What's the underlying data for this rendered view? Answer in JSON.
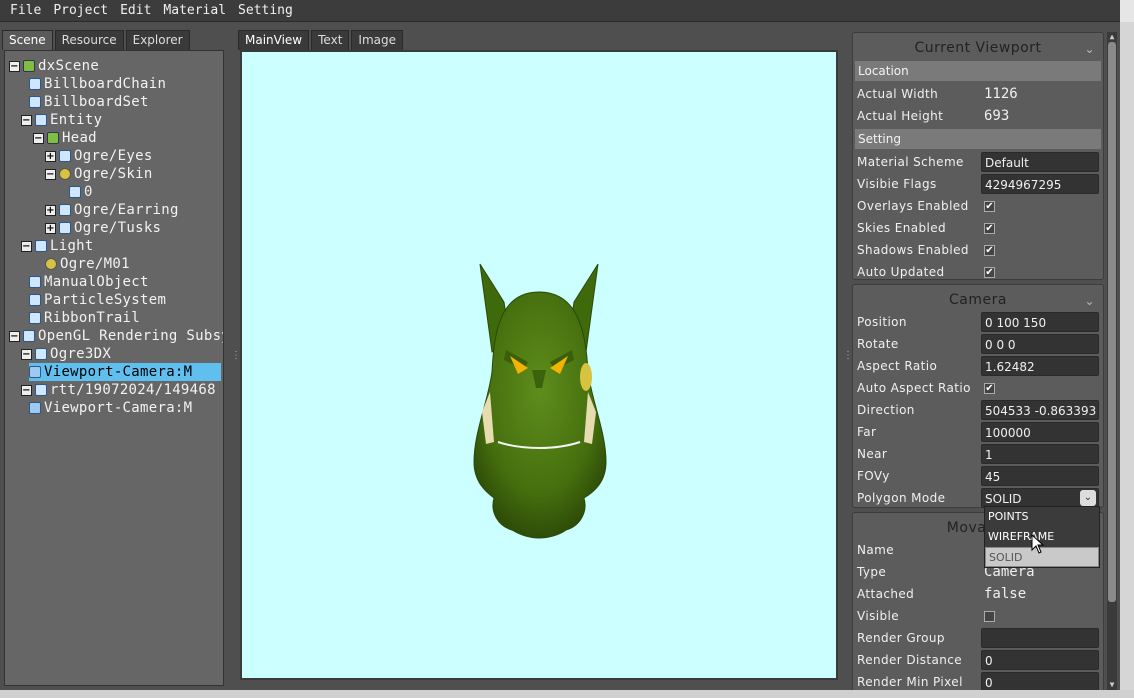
{
  "menu": [
    "File",
    "Project",
    "Edit",
    "Material",
    "Setting"
  ],
  "left_tabs": [
    "Scene",
    "Resource",
    "Explorer"
  ],
  "tree": [
    {
      "label": "dxScene",
      "exp": "−",
      "icon": "scene"
    },
    {
      "label": "BillboardChain",
      "exp": "",
      "icon": "node"
    },
    {
      "label": "BillboardSet",
      "exp": "",
      "icon": "node"
    },
    {
      "label": "Entity",
      "exp": "−",
      "icon": "node"
    },
    {
      "label": "Head",
      "exp": "−",
      "icon": "scene"
    },
    {
      "label": "Ogre/Eyes",
      "exp": "+",
      "icon": "node"
    },
    {
      "label": "Ogre/Skin",
      "exp": "−",
      "icon": "mat"
    },
    {
      "label": "0",
      "exp": "",
      "icon": "node"
    },
    {
      "label": "Ogre/Earring",
      "exp": "+",
      "icon": "node"
    },
    {
      "label": "Ogre/Tusks",
      "exp": "+",
      "icon": "node"
    },
    {
      "label": "Light",
      "exp": "−",
      "icon": "node"
    },
    {
      "label": "Ogre/M01",
      "exp": "",
      "icon": "mat"
    },
    {
      "label": "ManualObject",
      "exp": "",
      "icon": "node"
    },
    {
      "label": "ParticleSystem",
      "exp": "",
      "icon": "node"
    },
    {
      "label": "RibbonTrail",
      "exp": "",
      "icon": "node"
    },
    {
      "label": "OpenGL Rendering Subsy",
      "exp": "−",
      "icon": "node"
    },
    {
      "label": "Ogre3DX",
      "exp": "−",
      "icon": "node"
    },
    {
      "label": "Viewport-Camera:M",
      "exp": "",
      "icon": "cam"
    },
    {
      "label": "rtt/19072024/149468",
      "exp": "−",
      "icon": "node"
    },
    {
      "label": "Viewport-Camera:M",
      "exp": "",
      "icon": "cam"
    }
  ],
  "center_tabs": [
    "MainView",
    "Text",
    "Image"
  ],
  "viewport_group": {
    "title": "Current Viewport",
    "location_section": "Location",
    "actual_width_label": "Actual Width",
    "actual_width": "1126",
    "actual_height_label": "Actual Height",
    "actual_height": "693",
    "setting_section": "Setting",
    "material_scheme_label": "Material Scheme",
    "material_scheme": "Default",
    "visible_flags_label": "Visibie Flags",
    "visible_flags": "4294967295",
    "overlays_label": "Overlays Enabled",
    "skies_label": "Skies Enabled",
    "shadows_label": "Shadows Enabled",
    "auto_updated_label": "Auto Updated",
    "check_mark": "✔"
  },
  "camera_group": {
    "title": "Camera",
    "position_label": "Position",
    "position": "0 100 150",
    "rotate_label": "Rotate",
    "rotate": "0 0 0",
    "aspect_label": "Aspect Ratio",
    "aspect": "1.62482",
    "auto_aspect_label": "Auto Aspect Ratio",
    "direction_label": "Direction",
    "direction": "504533 -0.863393",
    "far_label": "Far",
    "far": "100000",
    "near_label": "Near",
    "near": "1",
    "fovy_label": "FOVy",
    "fovy": "45",
    "polygon_label": "Polygon Mode",
    "polygon": "SOLID"
  },
  "dropdown_options": [
    "POINTS",
    "WIREFRAME",
    "SOLID"
  ],
  "movable_group": {
    "title": "Movable",
    "name_label": "Name",
    "type_label": "Type",
    "type": "Camera",
    "attached_label": "Attached",
    "attached": "false",
    "visible_label": "Visible",
    "render_group_label": "Render Group",
    "render_distance_label": "Render Distance",
    "render_distance": "0",
    "render_min_pixel_label": "Render Min Pixel",
    "render_min_pixel": "0"
  },
  "colors": {
    "viewport_bg": "#ccffff",
    "selection": "#5fbfef",
    "ogre_skin": "#4e7a10"
  }
}
